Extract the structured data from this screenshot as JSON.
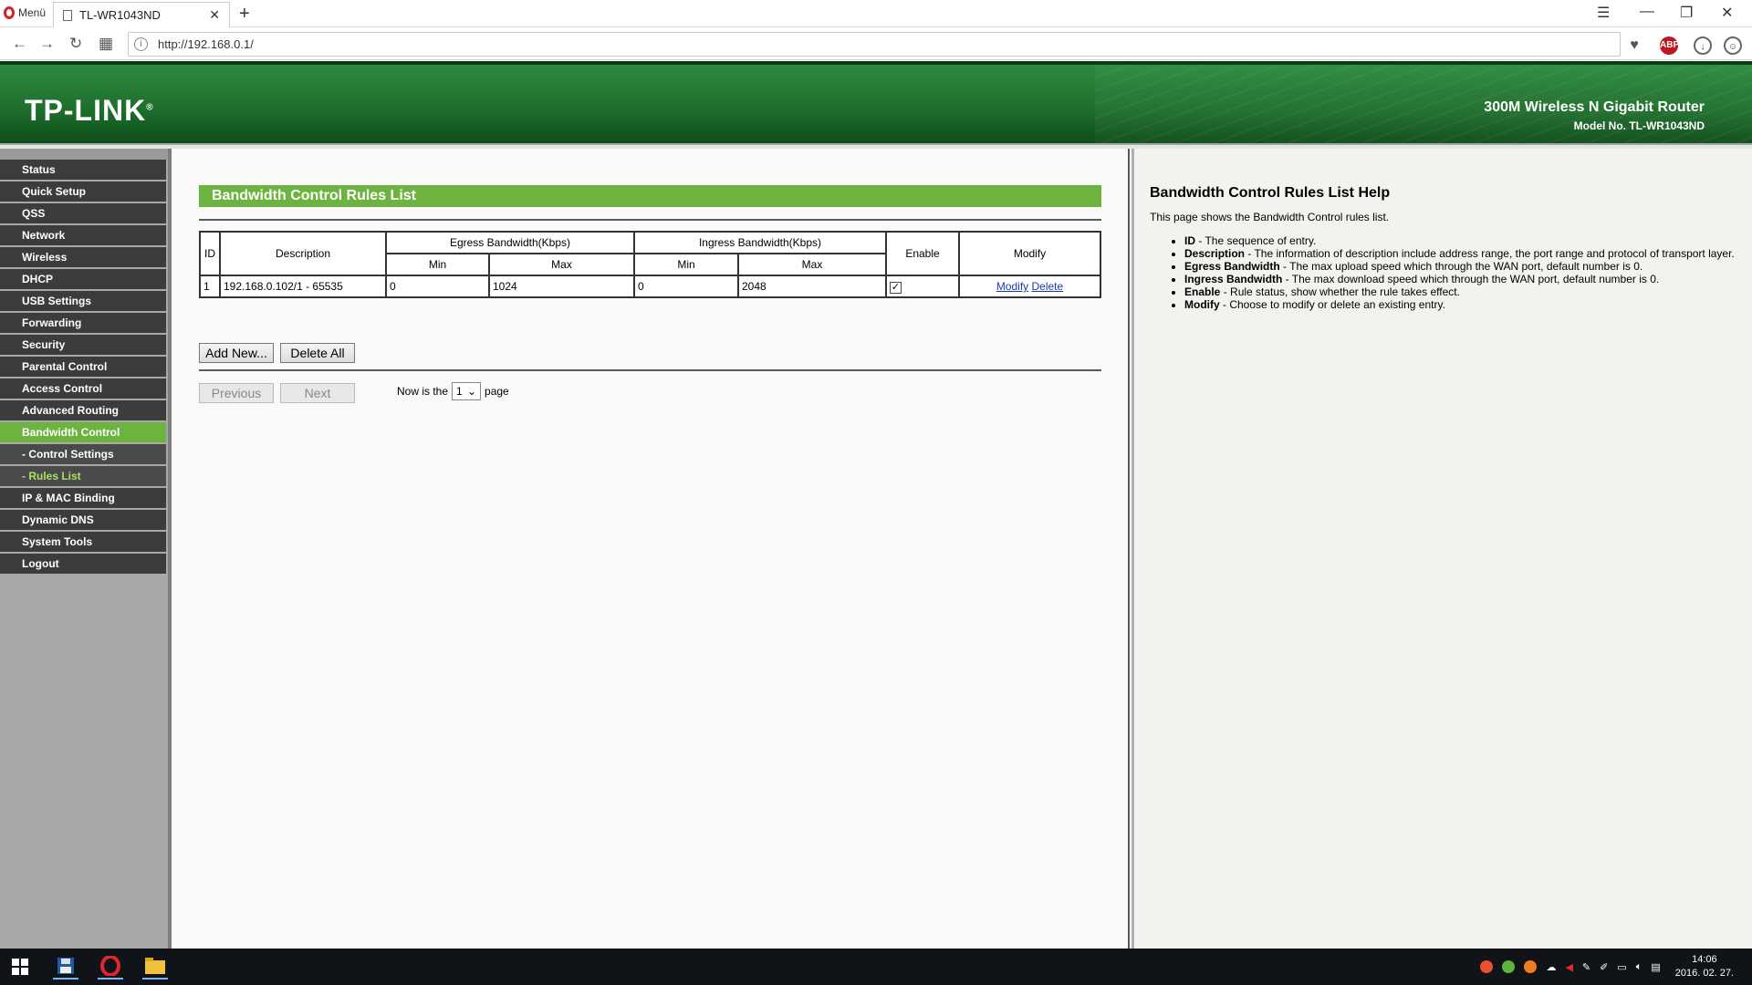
{
  "browser": {
    "menu_label": "Menü",
    "tab_title": "TL-WR1043ND",
    "url": "http://192.168.0.1/",
    "new_tab": "+",
    "tab_close": "✕"
  },
  "banner": {
    "logo": "TP-LINK",
    "product_name": "300M Wireless N Gigabit Router",
    "model": "Model No. TL-WR1043ND"
  },
  "nav": {
    "items": [
      {
        "label": "Status"
      },
      {
        "label": "Quick Setup"
      },
      {
        "label": "QSS"
      },
      {
        "label": "Network"
      },
      {
        "label": "Wireless"
      },
      {
        "label": "DHCP"
      },
      {
        "label": "USB Settings"
      },
      {
        "label": "Forwarding"
      },
      {
        "label": "Security"
      },
      {
        "label": "Parental Control"
      },
      {
        "label": "Access Control"
      },
      {
        "label": "Advanced Routing"
      },
      {
        "label": "Bandwidth Control"
      },
      {
        "label": "- Control Settings"
      },
      {
        "label": "- Rules List"
      },
      {
        "label": "IP & MAC Binding"
      },
      {
        "label": "Dynamic DNS"
      },
      {
        "label": "System Tools"
      },
      {
        "label": "Logout"
      }
    ]
  },
  "main": {
    "title": "Bandwidth Control Rules List",
    "table": {
      "headers": {
        "id": "ID",
        "description": "Description",
        "egress": "Egress Bandwidth(Kbps)",
        "ingress": "Ingress Bandwidth(Kbps)",
        "enable": "Enable",
        "modify": "Modify",
        "min": "Min",
        "max": "Max"
      },
      "rows": [
        {
          "id": "1",
          "description": "192.168.0.102/1 - 65535",
          "egress_min": "0",
          "egress_max": "1024",
          "ingress_min": "0",
          "ingress_max": "2048",
          "enabled": true,
          "modify_link": "Modify",
          "delete_link": "Delete"
        }
      ]
    },
    "add_new_button": "Add New...",
    "delete_all_button": "Delete All",
    "previous_button": "Previous",
    "next_button": "Next",
    "pager_prefix": "Now is the",
    "pager_value": "1",
    "pager_suffix": "page"
  },
  "help": {
    "title": "Bandwidth Control Rules List Help",
    "intro": "This page shows the Bandwidth Control rules list.",
    "items": [
      {
        "term": "ID",
        "text": " - The sequence of entry."
      },
      {
        "term": "Description",
        "text": " - The information of description include address range, the port range and protocol of transport layer."
      },
      {
        "term": "Egress Bandwidth",
        "text": " - The max upload speed which through the WAN port, default number is 0."
      },
      {
        "term": "Ingress Bandwidth",
        "text": " - The max download speed which through the WAN port, default number is 0."
      },
      {
        "term": "Enable",
        "text": " - Rule status, show whether the rule takes effect."
      },
      {
        "term": "Modify",
        "text": " - Choose to modify or delete an existing entry."
      }
    ]
  },
  "taskbar": {
    "time": "14:06",
    "date": "2016. 02. 27."
  },
  "colors": {
    "accent_green": "#6db33f",
    "banner_green": "#1d6d2b",
    "nav_dark": "#3c3c3c",
    "link_blue": "#1a3ab0"
  }
}
